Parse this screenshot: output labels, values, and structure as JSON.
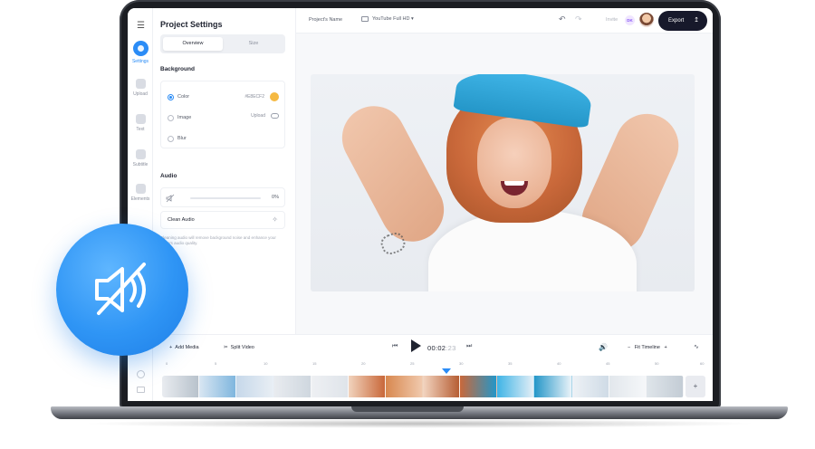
{
  "sidebar": {
    "items": [
      {
        "label": "Settings",
        "icon": "settings-icon",
        "active": true
      },
      {
        "label": "Upload",
        "icon": "upload-icon"
      },
      {
        "label": "Text",
        "icon": "text-icon"
      },
      {
        "label": "Subtitle",
        "icon": "subtitle-icon"
      },
      {
        "label": "Elements",
        "icon": "elements-icon"
      }
    ]
  },
  "panel": {
    "title": "Project Settings",
    "tabs": [
      "Overview",
      "Size"
    ],
    "background_heading": "Background",
    "options": {
      "color_label": "Color",
      "color_value": "#E8ECF2",
      "image_label": "Image",
      "upload_label": "Upload",
      "blur_label": "Blur"
    },
    "audio_heading": "Audio",
    "audio_volume": "0%",
    "clean_audio_label": "Clean Audio",
    "hint": "Cleaning audio will remove background noise and enhance your video's audio quality."
  },
  "topbar": {
    "project_name": "Project's Name",
    "format": "YouTube Full HD",
    "invite": "Invite",
    "user_initials": "DK",
    "export_label": "Export"
  },
  "transport": {
    "add_media": "Add Media",
    "split_video": "Split Video",
    "time_main": "00:02",
    "time_frac": ":23",
    "zoom_label": "Fit Timeline"
  },
  "ruler_ticks": [
    "0",
    "5",
    "10",
    "15",
    "20",
    "25",
    "30",
    "35",
    "40",
    "45",
    "50",
    "60"
  ],
  "colors": {
    "accent": "#2B8CF6",
    "export_bg": "#17192B",
    "hat": "#2496C8",
    "swatch": "#F5B942"
  }
}
